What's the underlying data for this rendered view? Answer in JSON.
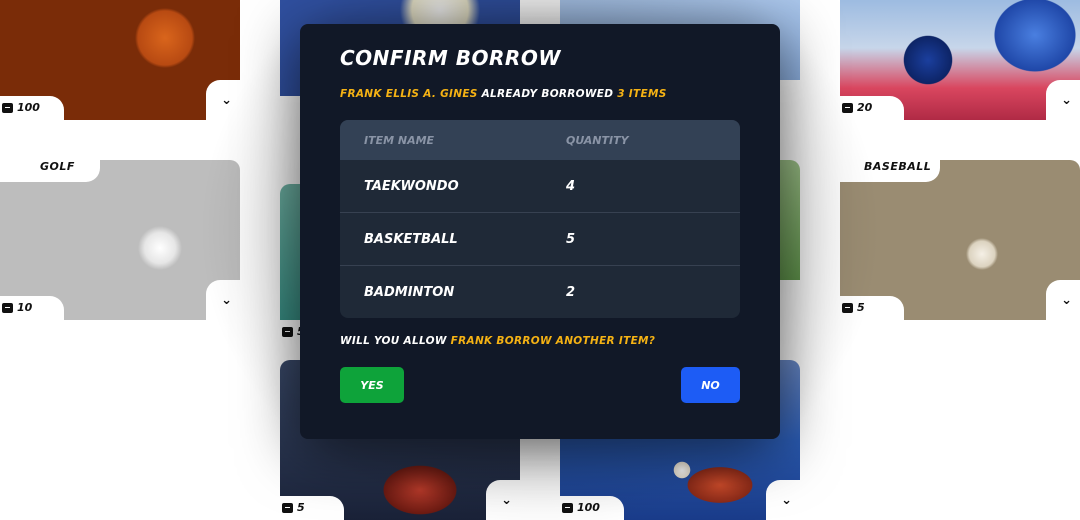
{
  "cards": [
    {
      "id": "basketball",
      "quantity": "100",
      "title": ""
    },
    {
      "id": "volleyball",
      "quantity": "",
      "title": ""
    },
    {
      "id": "badminton",
      "quantity": "",
      "title": ""
    },
    {
      "id": "taekwondo",
      "quantity": "20",
      "title": ""
    },
    {
      "id": "golf",
      "quantity": "10",
      "title": "GOLF"
    },
    {
      "id": "swimming",
      "quantity": "5",
      "title": ""
    },
    {
      "id": "tennis",
      "quantity": "",
      "title": ""
    },
    {
      "id": "baseball",
      "quantity": "5",
      "title": "BASEBALL"
    },
    {
      "id": "boxing",
      "quantity": "5",
      "title": ""
    },
    {
      "id": "table-tennis",
      "quantity": "100",
      "title": ""
    }
  ],
  "modal": {
    "title": "CONFIRM BORROW",
    "borrower_full": "FRANK ELLIS A. GINES",
    "already_text": "ALREADY BORROWED",
    "item_count": "3 ITEMS",
    "table": {
      "headers": [
        "ITEM NAME",
        "QUANTITY"
      ],
      "rows": [
        {
          "name": "TAEKWONDO",
          "quantity": "4"
        },
        {
          "name": "BASKETBALL",
          "quantity": "5"
        },
        {
          "name": "BADMINTON",
          "quantity": "2"
        }
      ]
    },
    "question_prefix": "WILL YOU ALLOW",
    "question_highlight": "FRANK BORROW ANOTHER ITEM?",
    "yes_label": "YES",
    "no_label": "NO"
  },
  "colors": {
    "accent_yellow": "#f5b214",
    "yes_green": "#0ea33a",
    "no_blue": "#1d5cf5",
    "modal_bg": "#111827"
  }
}
